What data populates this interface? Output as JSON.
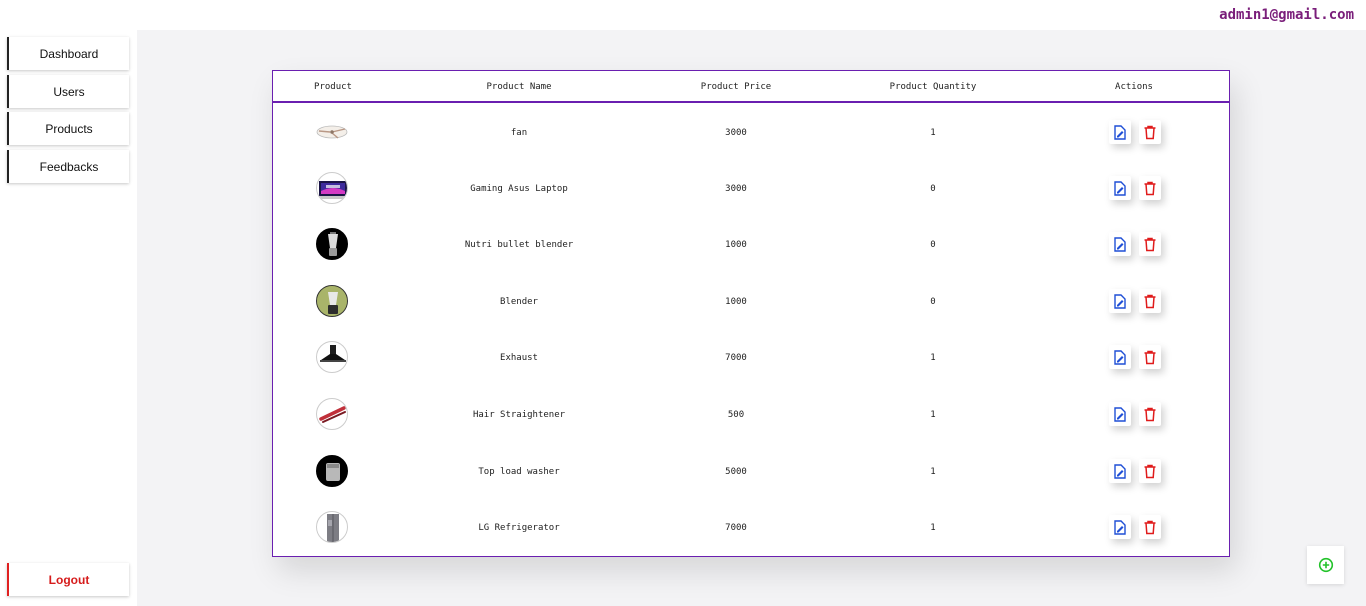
{
  "sidebar": {
    "items": [
      {
        "label": "Dashboard"
      },
      {
        "label": "Users"
      },
      {
        "label": "Products"
      },
      {
        "label": "Feedbacks"
      }
    ],
    "logout_label": "Logout"
  },
  "header": {
    "user_email": "admin1@gmail.com"
  },
  "table": {
    "columns": [
      "Product",
      "Product Name",
      "Product Price",
      "Product Quantity",
      "Actions"
    ],
    "rows": [
      {
        "image_icon": "fan-thumbnail",
        "name": "fan",
        "price": "3000",
        "quantity": "1"
      },
      {
        "image_icon": "laptop-thumbnail",
        "name": "Gaming Asus Laptop",
        "price": "3000",
        "quantity": "0"
      },
      {
        "image_icon": "blender-thumbnail",
        "name": "Nutri bullet blender",
        "price": "1000",
        "quantity": "0"
      },
      {
        "image_icon": "blender-thumbnail",
        "name": "Blender",
        "price": "1000",
        "quantity": "0"
      },
      {
        "image_icon": "exhaust-hood-thumbnail",
        "name": "Exhaust",
        "price": "7000",
        "quantity": "1"
      },
      {
        "image_icon": "hair-straightener-thumbnail",
        "name": "Hair Straightener",
        "price": "500",
        "quantity": "1"
      },
      {
        "image_icon": "washer-thumbnail",
        "name": "Top load washer",
        "price": "5000",
        "quantity": "1"
      },
      {
        "image_icon": "refrigerator-thumbnail",
        "name": "LG Refrigerator",
        "price": "7000",
        "quantity": "1"
      }
    ],
    "actions": {
      "edit_icon": "edit-icon",
      "delete_icon": "trash-icon"
    }
  },
  "fab": {
    "icon": "plus-circle-icon"
  },
  "colors": {
    "accent": "#6a1fb0",
    "email": "#7a1e7a",
    "edit": "#1f4fd6",
    "delete": "#e01b1b",
    "add": "#22c22a",
    "logout": "#d61b1b"
  }
}
